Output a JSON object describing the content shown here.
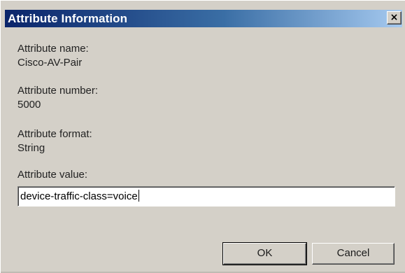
{
  "dialog": {
    "title": "Attribute Information",
    "close_glyph": "×"
  },
  "fields": {
    "name_label": "Attribute name:",
    "name_value": "Cisco-AV-Pair",
    "number_label": "Attribute number:",
    "number_value": "5000",
    "format_label": "Attribute format:",
    "format_value": "String",
    "value_label": "Attribute value:",
    "value_input": "device-traffic-class=voice"
  },
  "buttons": {
    "ok_label": "OK",
    "cancel_label": "Cancel"
  },
  "colors": {
    "title_bar_start": "#0a246a",
    "title_bar_end": "#a6caf0",
    "dialog_background": "#d4d0c8"
  },
  "icons": {
    "close": "close-icon"
  }
}
